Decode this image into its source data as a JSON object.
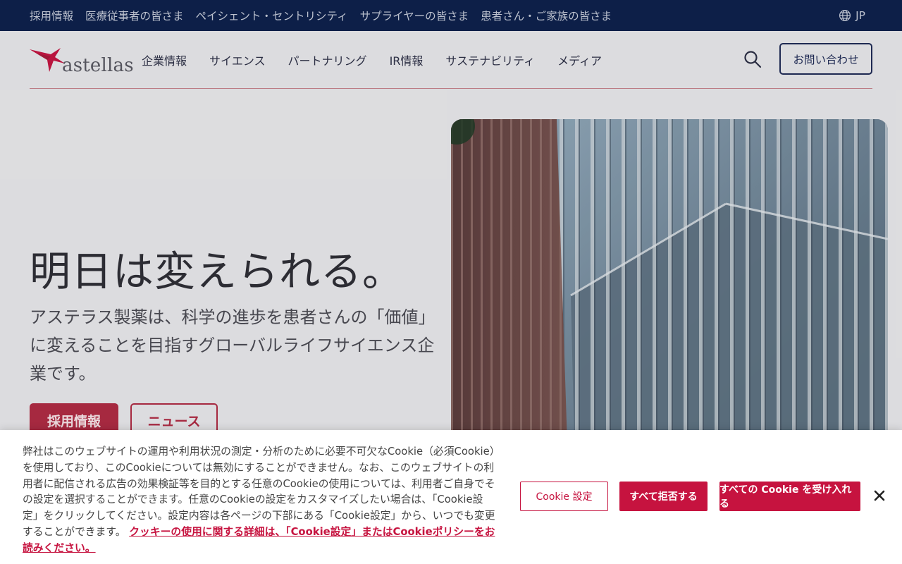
{
  "topbar": {
    "links": [
      "採用情報",
      "医療従事者の皆さま",
      "ペイシェント・セントリシティ",
      "サプライヤーの皆さま",
      "患者さん・ご家族の皆さま"
    ],
    "language": "JP",
    "language_icon": "globe-icon"
  },
  "header": {
    "logo_text": "astellas",
    "nav": [
      "企業情報",
      "サイエンス",
      "パートナリング",
      "IR情報",
      "サステナビリティ",
      "メディア"
    ],
    "search_icon": "search-icon",
    "contact_label": "お問い合わせ"
  },
  "hero": {
    "title": "明日は変えられる。",
    "description": "アステラス製薬は、科学の進歩を患者さんの「価値」に変えることを目指すグローバルライフサイエンス企業です。",
    "primary_button": "採用情報",
    "secondary_button": "ニュース"
  },
  "cookie": {
    "text": "弊社はこのウェブサイトの運用や利用状況の測定・分析のために必要不可欠なCookie（必須Cookie）を使用しており、このCookieについては無効にすることができません。なお、このウェブサイトの利用者に配信される広告の効果検証等を目的とする任意のCookieの使用については、利用者ご自身でその設定を選択することができます。任意のCookieの設定をカスタマイズしたい場合は、「Cookie設定」をクリックしてください。設定内容は各ページの下部にある「Cookie設定」から、いつでも変更することができます。",
    "link_text": "クッキーの使用に関する詳細は、「Cookie設定」またはCookieポリシーをお読みください。",
    "settings_button": "Cookie 設定",
    "reject_button": "すべて拒否する",
    "accept_button": "すべての Cookie を受け入れる",
    "close_icon": "close-icon"
  },
  "colors": {
    "topbar_bg": "#0b1f4a",
    "brand_red": "#c6133f",
    "navy": "#1e2a55"
  }
}
